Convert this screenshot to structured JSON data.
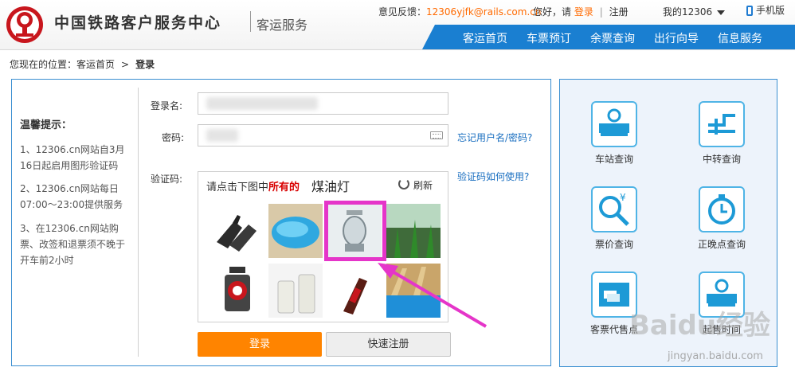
{
  "header": {
    "title": "中国铁路客户服务中心",
    "subtitle": "客运服务",
    "feedback_label": "意见反馈：",
    "feedback_email": "12306yjfk@rails.com.cn",
    "greeting": "您好，请",
    "login_link": "登录",
    "separator": "|",
    "register_link": "注册",
    "my12306": "我的12306",
    "mobile": "手机版"
  },
  "nav": {
    "items": [
      "客运首页",
      "车票预订",
      "余票查询",
      "出行向导",
      "信息服务"
    ]
  },
  "breadcrumb": {
    "prefix": "您现在的位置：",
    "home": "客运首页",
    "gt": ">",
    "current": "登录"
  },
  "tips": {
    "title": "温馨提示：",
    "items": [
      "1、12306.cn网站自3月16日起启用图形验证码",
      "2、12306.cn网站每日07:00～23:00提供服务",
      "3、在12306.cn网站购票、改签和退票须不晚于开车前2小时"
    ]
  },
  "form": {
    "username_label": "登录名:",
    "password_label": "密码:",
    "captcha_label": "验证码:",
    "forgot_link": "忘记用户名/密码?",
    "captcha_help_link": "验证码如何使用?",
    "login_button": "登录",
    "register_button": "快速注册"
  },
  "captcha": {
    "prompt_prefix": "请点击下图中",
    "prompt_emphasis": "所有的",
    "target_word": "煤油灯",
    "refresh": "刷新",
    "images": [
      "gloves",
      "swimming-pool",
      "kerosene-lamp",
      "aquarium",
      "railway-lantern",
      "milk-bottles",
      "cola-bottle",
      "water-slide"
    ]
  },
  "services": {
    "items": [
      {
        "label": "车站查询",
        "icon": "station-icon"
      },
      {
        "label": "中转查询",
        "icon": "transfer-icon"
      },
      {
        "label": "票价查询",
        "icon": "fare-search-icon"
      },
      {
        "label": "正晚点查询",
        "icon": "stopwatch-icon"
      },
      {
        "label": "客票代售点",
        "icon": "ticket-agent-icon"
      },
      {
        "label": "起售时间",
        "icon": "station-icon"
      }
    ]
  },
  "watermark": {
    "logo": "Baidu经验",
    "url": "jingyan.baidu.com"
  },
  "colors": {
    "nav_blue": "#1a7fd1",
    "accent_orange": "#ff8400",
    "highlight_magenta": "#e535c9"
  }
}
